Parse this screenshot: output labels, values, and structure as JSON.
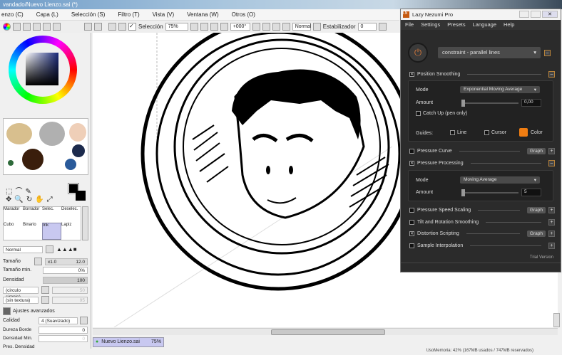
{
  "window": {
    "title": "vandado/Nuevo Lienzo.sai (*)"
  },
  "menu": [
    "enzo (C)",
    "Capa (L)",
    "Selección (S)",
    "Filtro (T)",
    "Vista (V)",
    "Ventana (W)",
    "Otros (O)"
  ],
  "toolbar": {
    "selection_label": "Selección",
    "zoom": "75%",
    "rotation": "+000°",
    "blend": "Normal",
    "stabilizer_label": "Estabilizador",
    "stabilizer": "0"
  },
  "left": {
    "tools": [
      "Marador",
      "Borrador",
      "Selec.",
      "Deselec.",
      "Cubo",
      "Binario",
      "Ink",
      "Lapiz"
    ],
    "blend_mode": "Normal",
    "size_label": "Tamaño",
    "size_mult": "x1.0",
    "size": "12.0",
    "min_size_label": "Tamaño min.",
    "min_size": "0%",
    "density_label": "Densidad",
    "density": "100",
    "shape": "(circulo simple)",
    "shape_val": "50",
    "texture": "(sin textura)",
    "texture_val": "95",
    "advanced_label": "Ajustes avanzados",
    "quality_label": "Calidad",
    "quality": "4 (Suavizado)",
    "hardness_label": "Dureza Borde",
    "hardness": "0",
    "min_density_label": "Densidad Min.",
    "min_density": "0",
    "pressure_label": "Pres. Densidad"
  },
  "doc_tab": {
    "name": "Nuevo Lienzo.sai",
    "zoom": "75%"
  },
  "status": "UsoMemoria: 42% (167MB usados / 747MB reservados)",
  "lnp": {
    "title": "Lazy Nezumi Pro",
    "menu": [
      "File",
      "Settings",
      "Presets",
      "Language",
      "Help"
    ],
    "preset": "constraint - parallel lines",
    "position_smoothing": "Position Smoothing",
    "mode_label": "Mode",
    "ps_mode": "Exponential Moving Average",
    "amount_label": "Amount",
    "ps_amount": "0,00",
    "catch_up": "Catch Up (pen only)",
    "guides_label": "Guides:",
    "line": "Line",
    "cursor": "Cursor",
    "color": "Color",
    "color_value": "#f07d12",
    "pressure_curve": "Pressure Curve",
    "graph": "Graph",
    "pressure_processing": "Pressure Processing",
    "pp_mode": "Moving Average",
    "pp_amount": "5",
    "pressure_speed": "Pressure Speed Scaling",
    "tilt": "Tilt and Rotation Smoothing",
    "distortion": "Distortion Scripting",
    "sample": "Sample Interpolation",
    "trial": "Trial Version"
  }
}
